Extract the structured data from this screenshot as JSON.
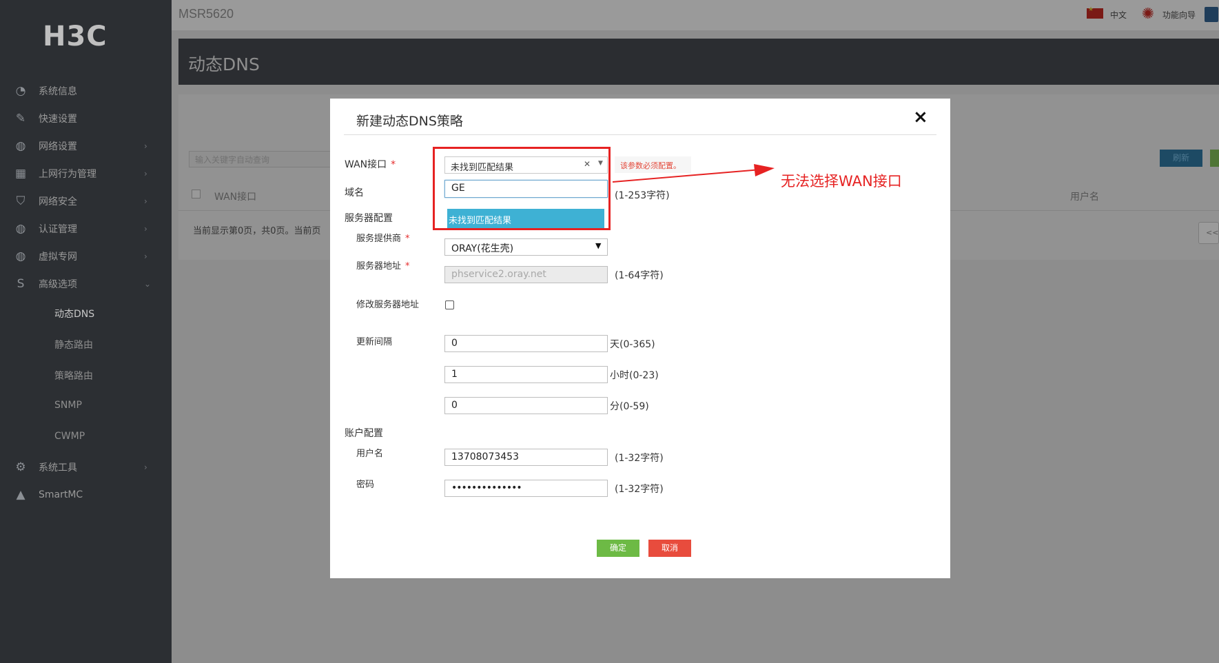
{
  "sidebar": {
    "logo": "H3C",
    "items": [
      {
        "label": "系统信息",
        "icon": "dashboard-icon",
        "glyph": "◔",
        "arrow": ""
      },
      {
        "label": "快速设置",
        "icon": "quick-settings-icon",
        "glyph": "✎",
        "arrow": ""
      },
      {
        "label": "网络设置",
        "icon": "globe-icon",
        "glyph": "◍",
        "arrow": "›"
      },
      {
        "label": "上网行为管理",
        "icon": "grid-icon",
        "glyph": "▦",
        "arrow": "›"
      },
      {
        "label": "网络安全",
        "icon": "shield-icon",
        "glyph": "⛉",
        "arrow": "›"
      },
      {
        "label": "认证管理",
        "icon": "globe-icon",
        "glyph": "◍",
        "arrow": "›"
      },
      {
        "label": "虚拟专网",
        "icon": "vpn-globe-icon",
        "glyph": "◍",
        "arrow": "›"
      },
      {
        "label": "高级选项",
        "icon": "advanced-icon",
        "glyph": "S",
        "arrow": "⌄"
      }
    ],
    "sub_items": [
      "动态DNS",
      "静态路由",
      "策略路由",
      "SNMP",
      "CWMP"
    ],
    "bottom_items": [
      {
        "label": "系统工具",
        "icon": "tools-icon",
        "glyph": "⚙",
        "arrow": "›"
      },
      {
        "label": "SmartMC",
        "icon": "smartmc-icon",
        "glyph": "▲",
        "arrow": ""
      }
    ]
  },
  "topbar": {
    "device": "MSR5620",
    "lang": "中文",
    "wizard": "功能向导"
  },
  "page": {
    "title": "动态DNS",
    "search_placeholder": "输入关键字自动查询",
    "col_wan": "WAN接口",
    "col_user": "用户名",
    "page_info": "当前显示第0页，共0页。当前页",
    "refresh": "刷新",
    "pager": "<<"
  },
  "dialog": {
    "title": "新建动态DNS策略",
    "close": "×",
    "wan_label": "WAN接口",
    "required_mark": "*",
    "wan_selected": "未找到匹配结果",
    "wan_search_value": "GE",
    "wan_result": "未找到匹配结果",
    "error_tip": "该参数必须配置。",
    "domain_label": "域名",
    "domain_hint": "(1-253字符)",
    "server_config": "服务器配置",
    "provider_label": "服务提供商",
    "provider_value": "ORAY(花生壳)",
    "server_addr_label": "服务器地址",
    "server_addr_value": "phservice2.oray.net",
    "server_addr_hint": "(1-64字符)",
    "modify_server_label": "修改服务器地址",
    "interval_label": "更新间隔",
    "interval_days": "0",
    "interval_days_unit": "天(0-365)",
    "interval_hours": "1",
    "interval_hours_unit": "小时(0-23)",
    "interval_minutes": "0",
    "interval_minutes_unit": "分(0-59)",
    "account_config": "账户配置",
    "username_label": "用户名",
    "username_value": "13708073453",
    "username_hint": "(1-32字符)",
    "password_label": "密码",
    "password_value": "••••••••••••••",
    "password_hint": "(1-32字符)",
    "ok": "确定",
    "cancel": "取消"
  },
  "annotation": {
    "text": "无法选择WAN接口",
    "color": "#e62222"
  }
}
